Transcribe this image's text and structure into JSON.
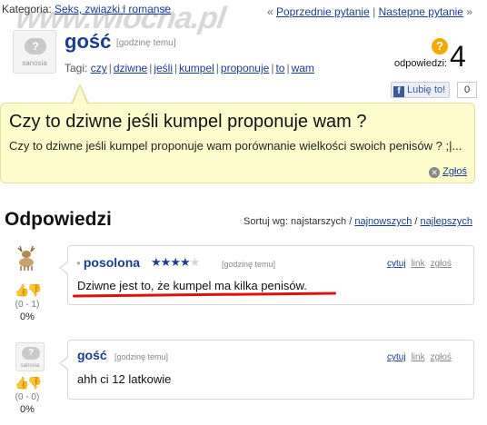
{
  "breadcrumb": {
    "label": "Kategoria:",
    "category": "Seks, związki i romanse"
  },
  "watermark": "www.wiocha.pl",
  "nav": {
    "prev_prefix": "«",
    "prev": "Poprzednie pytanie",
    "separator": "|",
    "next": "Nastepne pytanie",
    "next_suffix": "»"
  },
  "question": {
    "author": "gość",
    "time": "[godzinę temu]",
    "tags_label": "Tagi:",
    "tags": [
      "czy",
      "dziwne",
      "jeśli",
      "kumpel",
      "proponuje",
      "to",
      "wam"
    ],
    "answers_label": "odpowiedzi:",
    "answers_count": "4",
    "like_label": "Lubię to!",
    "like_count": "0",
    "title": "Czy to dziwne jeśli kumpel proponuje wam ?",
    "body": "Czy to dziwne jeśli kumpel proponuje wam porównanie wielkości swoich penisów ? ;|...",
    "report": "Zgłoś"
  },
  "answers_section": {
    "heading": "Odpowiedzi",
    "sort_label": "Sortuj wg:",
    "sort_active": "najstarszych",
    "sort_options": [
      "najnowszych",
      "najlepszych"
    ],
    "sort_separator": "/"
  },
  "avatar_brand": "sanosia",
  "answers": [
    {
      "author": "posolona",
      "rating": 3.5,
      "rating_max": 5,
      "time": "[godzinę temu]",
      "links": [
        "cytuj",
        "link",
        "zgłoś"
      ],
      "text": "Dziwne jest to, że kumpel ma kilka penisów.",
      "votes": "(0 - 1)",
      "percent": "0%"
    },
    {
      "author": "gość",
      "time": "[godzinę temu]",
      "links": [
        "cytuj",
        "link",
        "zgłoś"
      ],
      "text": "ahh ci 12 latkowie",
      "votes": "(0 - 0)",
      "percent": "0%"
    }
  ],
  "colors": {
    "link": "#1a3d8f",
    "question_bg": "#fefccd",
    "highlight": "#e01010",
    "thumb_up": "#c03a9c",
    "thumb_down": "#e0a000"
  }
}
